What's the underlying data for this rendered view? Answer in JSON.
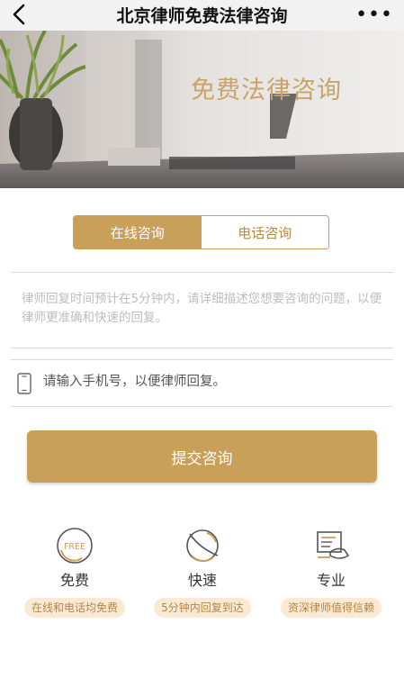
{
  "nav": {
    "title": "北京律师免费法律咨询",
    "more": "•••"
  },
  "banner": {
    "title": "免费法律咨询"
  },
  "tabs": [
    {
      "label": "在线咨询",
      "active": true
    },
    {
      "label": "电话咨询",
      "active": false
    }
  ],
  "form": {
    "question_placeholder": "律师回复时间预计在5分钟内，请详细描述您想要咨询的问题，以便律师更准确和快速的回复。",
    "phone_placeholder": "请输入手机号，以便律师回复。",
    "submit_label": "提交咨询"
  },
  "features": [
    {
      "icon": "free-icon",
      "icon_text": "FREE",
      "title": "免费",
      "badge": "在线和电话均免费"
    },
    {
      "icon": "speed-icon",
      "title": "快速",
      "badge": "5分钟内回复到达"
    },
    {
      "icon": "professional-icon",
      "title": "专业",
      "badge": "资深律师值得信赖"
    }
  ],
  "colors": {
    "accent": "#c9a059",
    "badge_bg": "#fbead3",
    "badge_text": "#b48548",
    "banner_title": "#c9a46a"
  }
}
